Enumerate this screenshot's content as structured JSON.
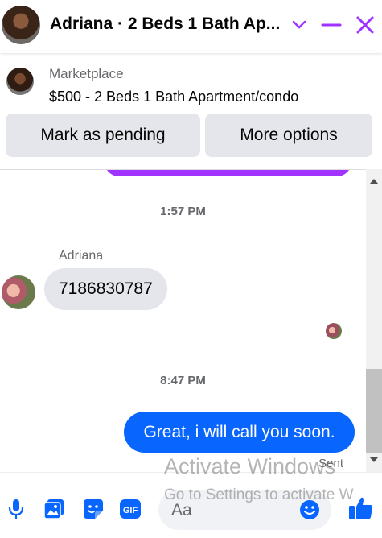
{
  "header": {
    "title": "Adriana · 2 Beds 1 Bath Ap...",
    "icons": [
      "chevron-down-icon",
      "minimize-icon",
      "close-icon"
    ],
    "accent": "#a033ff"
  },
  "marketplace": {
    "label": "Marketplace",
    "listing": "$500 - 2 Beds 1 Bath Apartment/condo",
    "buttons": {
      "pending": "Mark as pending",
      "more": "More options"
    }
  },
  "chat": {
    "timestamps": [
      "1:57 PM",
      "8:47 PM"
    ],
    "incoming": {
      "sender": "Adriana",
      "text": "7186830787"
    },
    "outgoing": {
      "text": "Great, i will call you soon.",
      "color": "#0866ff"
    },
    "status": "Sent"
  },
  "composer": {
    "placeholder": "Aa",
    "icons": [
      "microphone-icon",
      "image-icon",
      "sticker-icon",
      "gif-icon",
      "emoji-icon",
      "thumbs-up-icon"
    ],
    "gif_label": "GIF"
  },
  "watermark": {
    "line1": "Activate Windows",
    "line2": "Go to Settings to activate W"
  }
}
